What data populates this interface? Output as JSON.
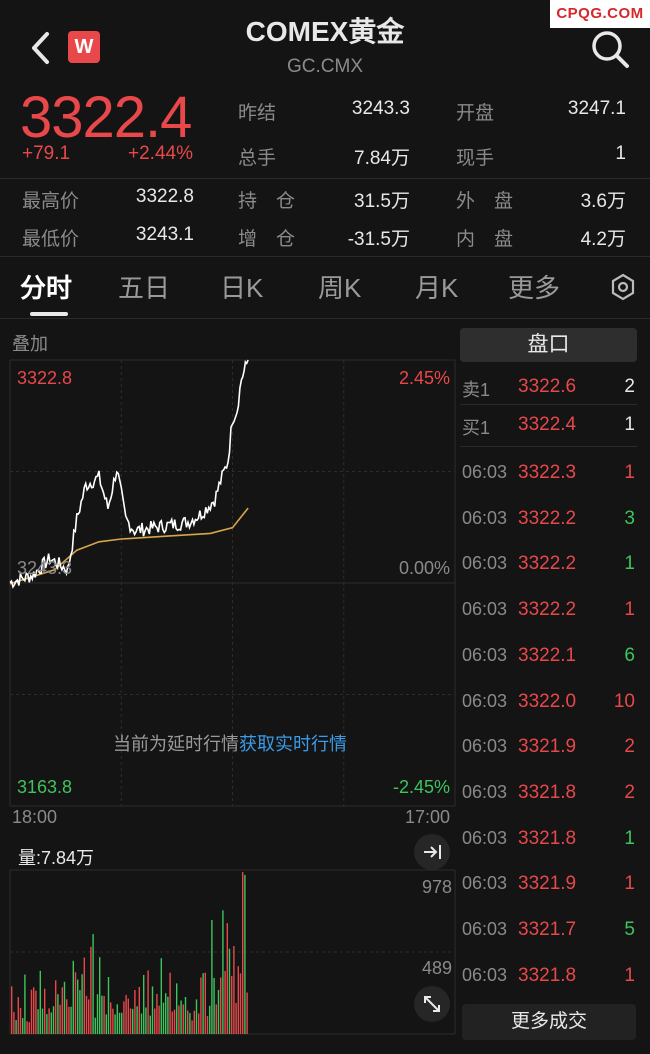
{
  "header": {
    "title": "COMEX黄金",
    "subtitle": "GC.CMX",
    "logo_letter": "W",
    "watermark": "CPQG.COM"
  },
  "quote": {
    "price": "3322.4",
    "change": "+79.1",
    "change_pct": "+2.44%",
    "stats": [
      {
        "label": "昨结",
        "value": "3243.3",
        "color": "white"
      },
      {
        "label": "开盘",
        "value": "3247.1",
        "color": "white"
      },
      {
        "label": "总手",
        "value": "7.84万",
        "color": "white"
      },
      {
        "label": "现手",
        "value": "1",
        "color": "white"
      },
      {
        "label": "最高价",
        "value": "3322.8",
        "color": "white"
      },
      {
        "label": "持　仓",
        "value": "31.5万",
        "color": "white"
      },
      {
        "label": "外　盘",
        "value": "3.6万",
        "color": "white"
      },
      {
        "label": "最低价",
        "value": "3243.1",
        "color": "white"
      },
      {
        "label": "增　仓",
        "value": "-31.5万",
        "color": "white"
      },
      {
        "label": "内　盘",
        "value": "4.2万",
        "color": "white"
      }
    ]
  },
  "tabs": [
    {
      "label": "分时",
      "active": true
    },
    {
      "label": "五日",
      "active": false
    },
    {
      "label": "日K",
      "active": false
    },
    {
      "label": "周K",
      "active": false
    },
    {
      "label": "月K",
      "active": false
    },
    {
      "label": "更多",
      "active": false
    }
  ],
  "chart": {
    "overlay_label": "叠加",
    "price_high": "3322.8",
    "pct_high": "2.45%",
    "price_mid": "3243.3",
    "pct_mid": "0.00%",
    "price_low": "3163.8",
    "pct_low": "-2.45%",
    "time_start": "18:00",
    "time_end": "17:00",
    "volume_label": "量:7.84万",
    "vol_max": "978",
    "vol_mid": "489",
    "delay_text": "当前为延时行情",
    "delay_link": "获取实时行情"
  },
  "orderbook": {
    "title": "盘口",
    "ask": {
      "label": "卖1",
      "price": "3322.6",
      "vol": "2"
    },
    "bid": {
      "label": "买1",
      "price": "3322.4",
      "vol": "1"
    },
    "trades": [
      {
        "time": "06:03",
        "price": "3322.3",
        "vol": "1",
        "dir": "red"
      },
      {
        "time": "06:03",
        "price": "3322.2",
        "vol": "3",
        "dir": "green"
      },
      {
        "time": "06:03",
        "price": "3322.2",
        "vol": "1",
        "dir": "green"
      },
      {
        "time": "06:03",
        "price": "3322.2",
        "vol": "1",
        "dir": "red"
      },
      {
        "time": "06:03",
        "price": "3322.1",
        "vol": "6",
        "dir": "green"
      },
      {
        "time": "06:03",
        "price": "3322.0",
        "vol": "10",
        "dir": "red"
      },
      {
        "time": "06:03",
        "price": "3321.9",
        "vol": "2",
        "dir": "red"
      },
      {
        "time": "06:03",
        "price": "3321.8",
        "vol": "2",
        "dir": "red"
      },
      {
        "time": "06:03",
        "price": "3321.8",
        "vol": "1",
        "dir": "green"
      },
      {
        "time": "06:03",
        "price": "3321.9",
        "vol": "1",
        "dir": "red"
      },
      {
        "time": "06:03",
        "price": "3321.7",
        "vol": "5",
        "dir": "green"
      },
      {
        "time": "06:03",
        "price": "3321.8",
        "vol": "1",
        "dir": "red"
      }
    ],
    "more_label": "更多成交"
  },
  "colors": {
    "up": "#e8484a",
    "down": "#3ec45c",
    "link": "#3a9be8",
    "avg_line": "#d9a54a",
    "price_line": "#ffffff"
  },
  "icons": {
    "back": "chevron-left-icon",
    "search": "search-icon",
    "settings": "gear-icon",
    "collapse": "arrow-right-bar-icon",
    "fullscreen": "expand-icon"
  }
}
